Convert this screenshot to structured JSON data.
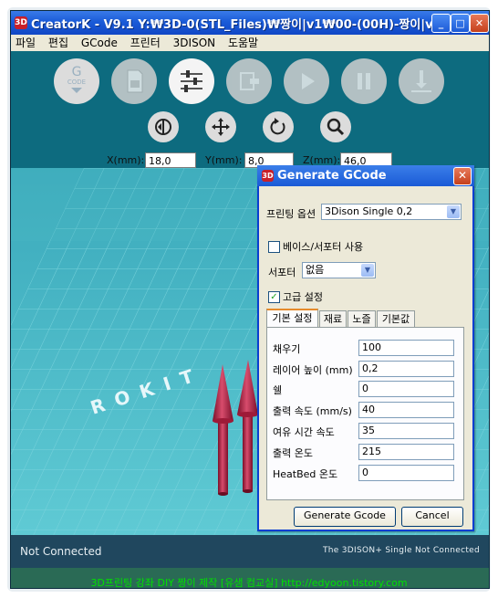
{
  "window": {
    "title": "CreatorK - V9.1  Y:₩3D-0(STL_Files)₩짱이|v1₩00-(00H)-짱이|v1(e...",
    "app_icon": "3D",
    "minimize": "_",
    "maximize": "□",
    "close": "✕"
  },
  "menu": [
    "파일",
    "편집",
    "GCode",
    "프린터",
    "3DISON",
    "도움말"
  ],
  "toolbar": {
    "gcode_label_top": "G",
    "gcode_label_bottom": "CODE"
  },
  "coords": {
    "x_label": "X(mm):",
    "x_value": "18,0",
    "y_label": "Y(mm):",
    "y_value": "8,0",
    "z_label": "Z(mm):",
    "z_value": "46,0"
  },
  "viewport": {
    "floor_text": "ROKIT"
  },
  "dialog": {
    "title": "Generate GCode",
    "icon": "3D",
    "close": "✕",
    "print_option_label": "프린팅 옵션",
    "print_option_value": "3Dison Single 0,2",
    "base_support_label": "베이스/서포터 사용",
    "support_label": "서포터",
    "support_value": "없음",
    "advanced_label": "고급 설정",
    "advanced_checked": "✓",
    "tabs": [
      "기본 설정",
      "재료",
      "노즐",
      "기본값"
    ],
    "params": [
      {
        "label": "채우기",
        "value": "100"
      },
      {
        "label": "레이어 높이 (mm)",
        "value": "0,2"
      },
      {
        "label": "쉘",
        "value": "0"
      },
      {
        "label": "출력 속도 (mm/s)",
        "value": "40"
      },
      {
        "label": "여유 시간 속도",
        "value": "35"
      },
      {
        "label": "출력 온도",
        "value": "215"
      },
      {
        "label": "HeatBed 온도",
        "value": "0"
      }
    ],
    "generate_button": "Generate Gcode",
    "cancel_button": "Cancel"
  },
  "status": {
    "left": "Not Connected",
    "right": "The 3DISON+ Single Not Connected"
  },
  "footer": "3D프린팅 강좌 DIY 짱이 제작 [유샘 컴교실]  http://edyoon.tistory.com"
}
